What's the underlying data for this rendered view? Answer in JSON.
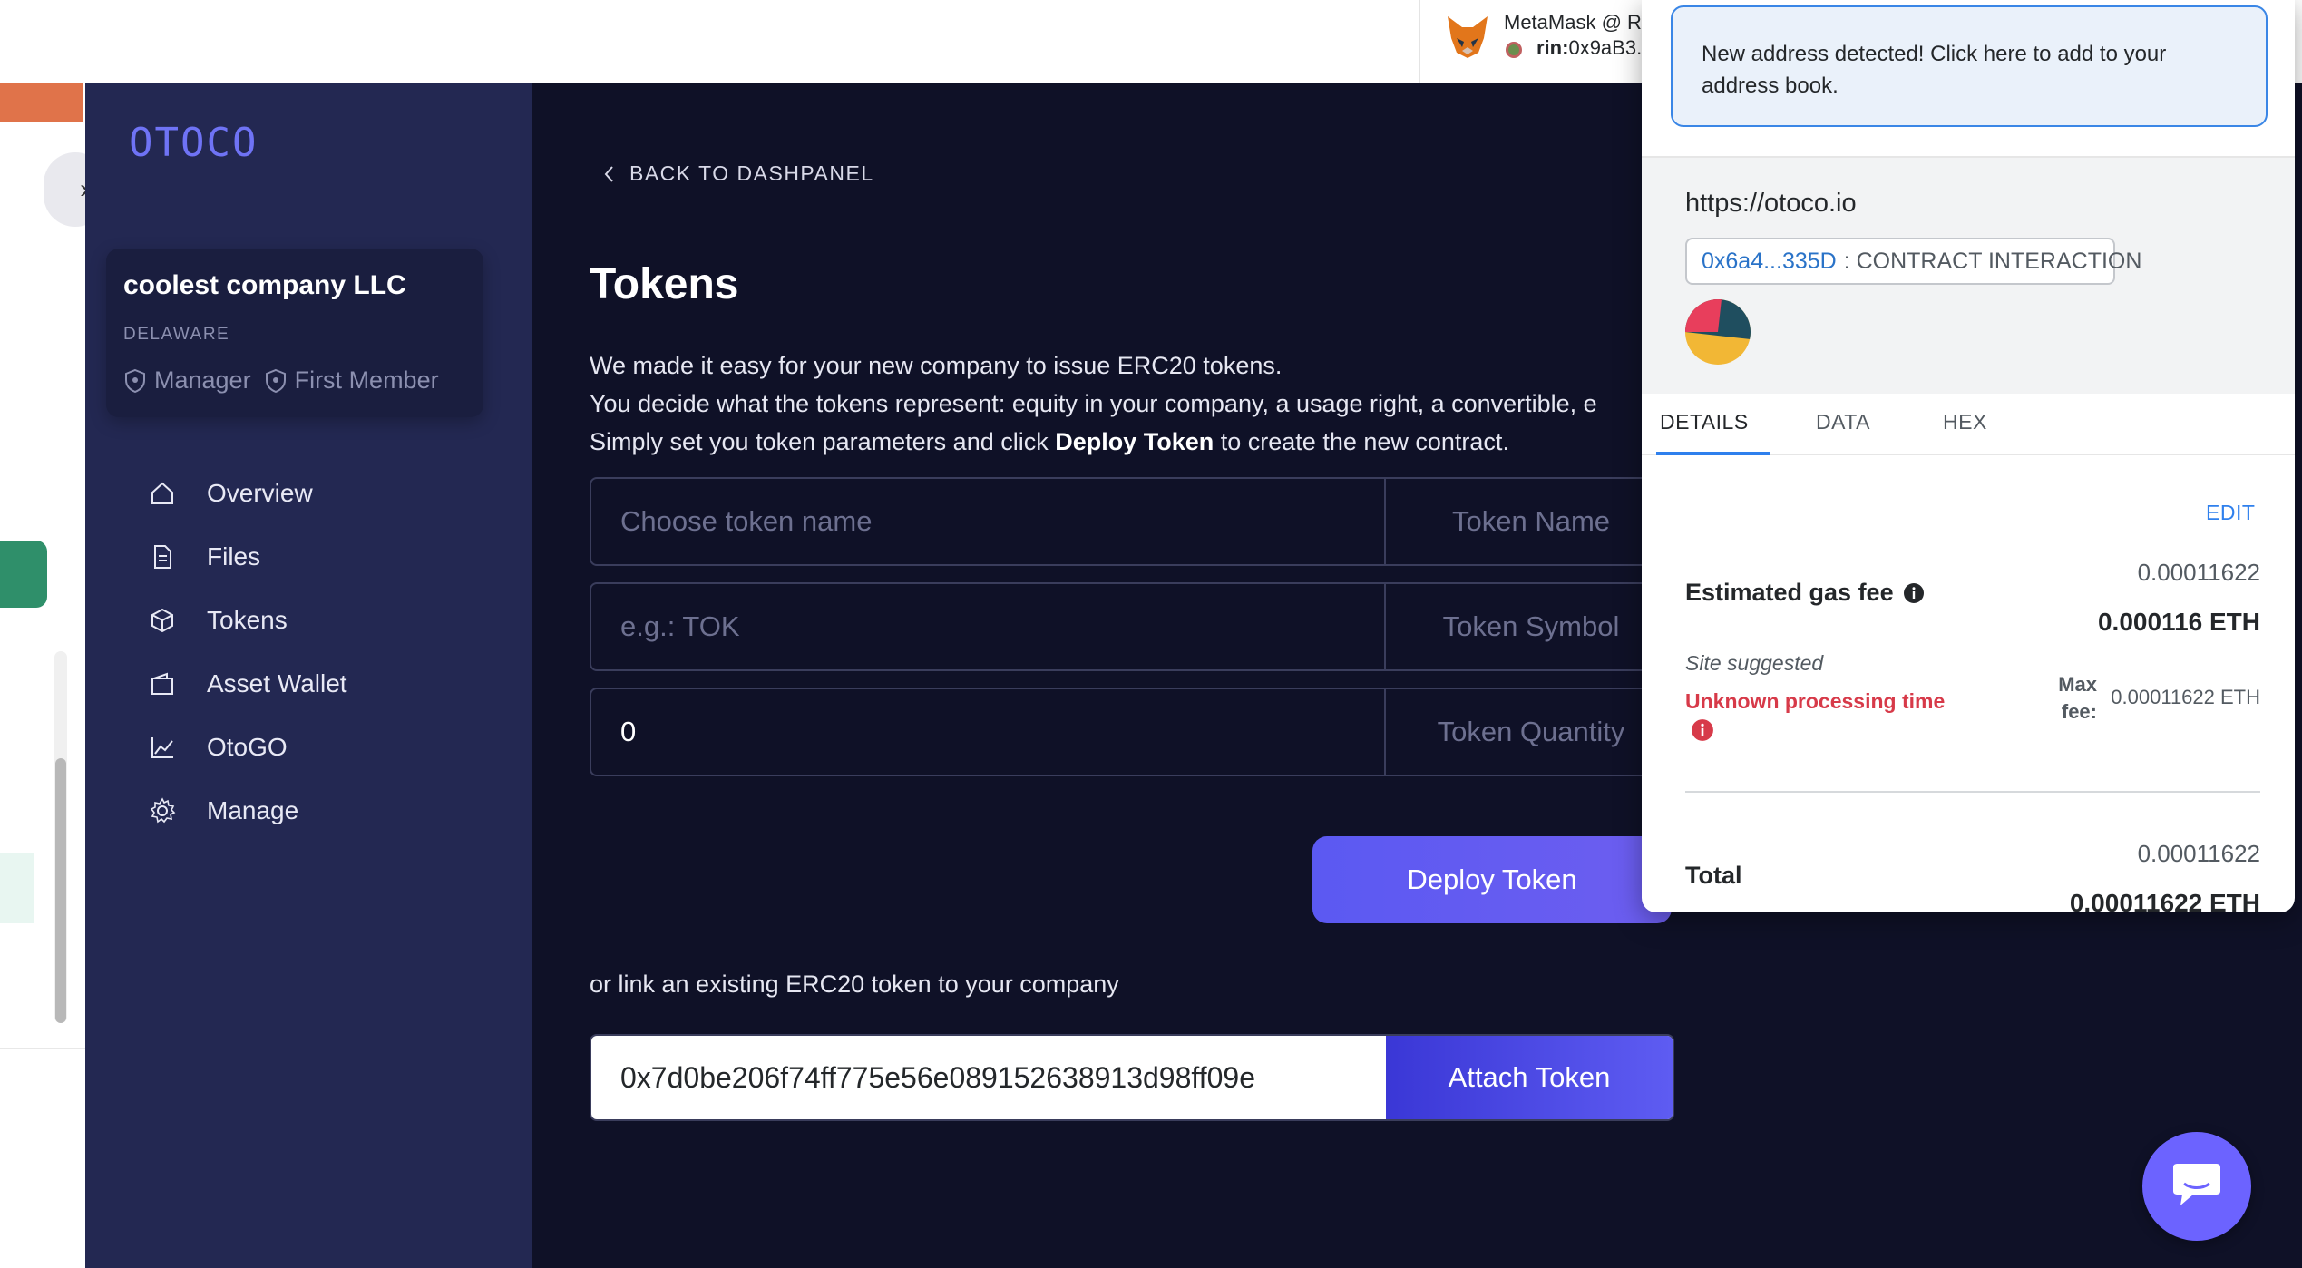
{
  "metamask_extension": {
    "title": "MetaMask @ R",
    "network_label": "rin:",
    "network_address": "0x9aB3."
  },
  "sidebar": {
    "logo": "OTOCO",
    "company": {
      "name": "coolest company LLC",
      "state": "DELAWARE",
      "role_1": "Manager",
      "role_2": "First Member"
    },
    "items": [
      {
        "label": "Overview",
        "icon": "home-icon"
      },
      {
        "label": "Files",
        "icon": "file-icon"
      },
      {
        "label": "Tokens",
        "icon": "cube-icon"
      },
      {
        "label": "Asset Wallet",
        "icon": "wallet-icon"
      },
      {
        "label": "OtoGO",
        "icon": "chart-line-icon"
      },
      {
        "label": "Manage",
        "icon": "gear-icon"
      }
    ]
  },
  "main": {
    "back_link": "BACK TO DASHPANEL",
    "title": "Tokens",
    "desc_line1": "We made it easy for your new company to issue ERC20 tokens.",
    "desc_line2": "You decide what the tokens represent: equity in your company, a usage right, a convertible, e",
    "desc_line3_pre": "Simply set you token parameters and click ",
    "desc_line3_bold": "Deploy Token",
    "desc_line3_post": " to create the new contract.",
    "fields": [
      {
        "placeholder": "Choose token name",
        "value": "",
        "label": "Token Name"
      },
      {
        "placeholder": "e.g.: TOK",
        "value": "",
        "label": "Token Symbol"
      },
      {
        "placeholder": "",
        "value": "0",
        "label": "Token Quantity"
      }
    ],
    "deploy_button": "Deploy Token",
    "link_text": "or link an existing ERC20 token to your company",
    "attach_value": "0x7d0be206f74ff775e56e089152638913d98ff09e",
    "attach_button": "Attach Token"
  },
  "metamask_popup": {
    "notice": "New address detected! Click here to add to your address book.",
    "origin": "https://otoco.io",
    "contract_address": "0x6a4...335D",
    "contract_type": ": CONTRACT INTERACTION",
    "tabs": [
      "DETAILS",
      "DATA",
      "HEX"
    ],
    "active_tab": "DETAILS",
    "edit_label": "EDIT",
    "gas_label": "Estimated gas fee",
    "gas_value_small": "0.00011622",
    "gas_value_big": "0.000116 ETH",
    "site_suggested": "Site suggested",
    "processing_time": "Unknown processing time",
    "max_fee_label": "Max fee:",
    "max_fee_value": "0.00011622 ETH",
    "total_label": "Total",
    "total_value_small": "0.00011622",
    "total_value_big": "0.00011622 ETH"
  },
  "colors": {
    "sidebar_bg": "#232852",
    "main_bg": "#0f1127",
    "accent": "#5b59f2",
    "link_blue": "#2f80ed",
    "error_red": "#d73a49"
  }
}
